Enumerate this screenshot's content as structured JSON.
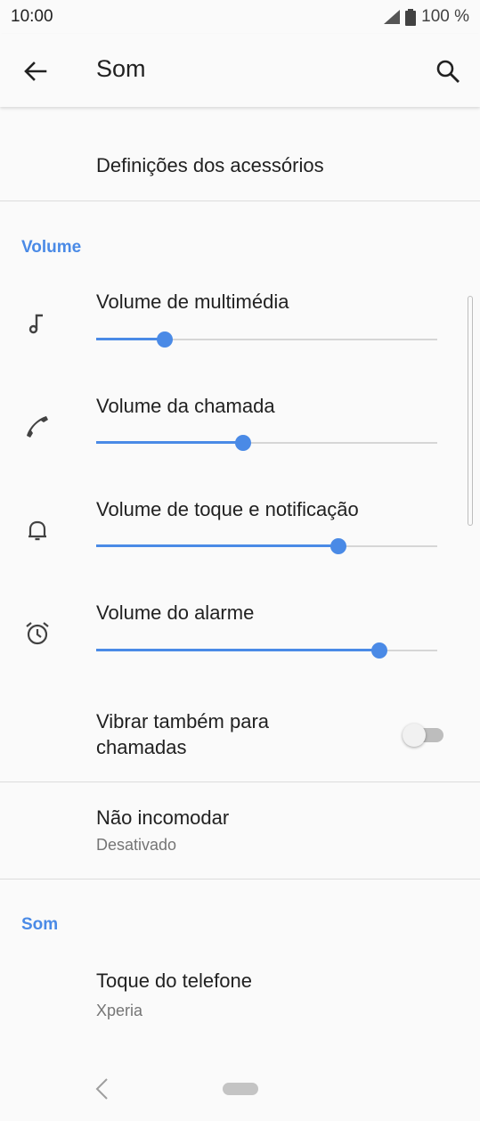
{
  "status_bar": {
    "time": "10:00",
    "battery": "100 %"
  },
  "app_bar": {
    "title": "Som",
    "back_icon": "arrow-back-icon",
    "search_icon": "search-icon"
  },
  "accessories": {
    "label": "Definições dos acessórios"
  },
  "volume_section": {
    "header": "Volume",
    "items": [
      {
        "label": "Volume de multimédia",
        "icon": "music-note-icon",
        "level": 0.2
      },
      {
        "label": "Volume da chamada",
        "icon": "phone-icon",
        "level": 0.43
      },
      {
        "label": "Volume de toque e notificação",
        "icon": "bell-icon",
        "level": 0.71
      },
      {
        "label": "Volume do alarme",
        "icon": "alarm-clock-icon",
        "level": 0.83
      }
    ]
  },
  "vibrate": {
    "label_line1": "Vibrar também para",
    "label_line2": "chamadas",
    "enabled": false
  },
  "dnd": {
    "label": "Não incomodar",
    "value": "Desativado"
  },
  "sound_section": {
    "header": "Som",
    "ringtone": {
      "label": "Toque do telefone",
      "value": "Xperia"
    }
  },
  "colors": {
    "accent": "#4a8ae6",
    "background": "#fafafa",
    "divider": "#dcdcdc"
  }
}
